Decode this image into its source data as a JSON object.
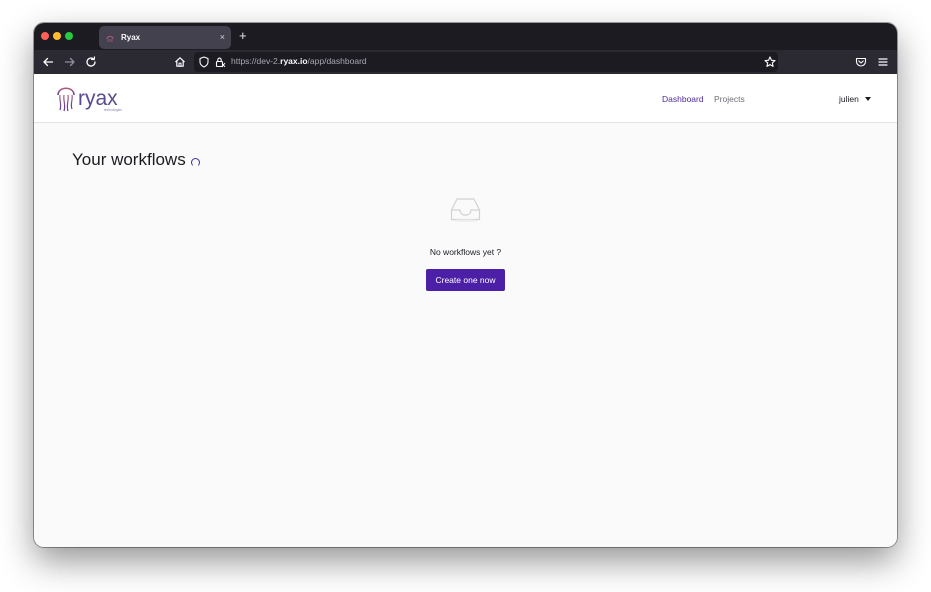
{
  "browser": {
    "tab": {
      "title": "Ryax",
      "favicon": "ryax-favicon-icon",
      "close": "×"
    },
    "new_tab": "+",
    "url": {
      "prefix": "https://dev-2.",
      "host": "ryax.io",
      "path": "/app/dashboard"
    },
    "icons": [
      "back-icon",
      "forward-icon",
      "reload-icon",
      "home-icon",
      "shield-icon",
      "lock-icon",
      "bookmark-star-icon",
      "pocket-icon",
      "menu-icon"
    ]
  },
  "app": {
    "logo_text": "ryax",
    "logo_subtext": "technologies",
    "nav": {
      "dashboard": "Dashboard",
      "projects": "Projects"
    },
    "user": "julien"
  },
  "page": {
    "title": "Your workflows",
    "empty_message": "No workflows yet ?",
    "create_button": "Create one now"
  },
  "colors": {
    "accent": "#4b1fa6",
    "nav_active": "#4b2a9e",
    "browser_chrome": "#1c1b22",
    "toolbar": "#2b2a33"
  }
}
